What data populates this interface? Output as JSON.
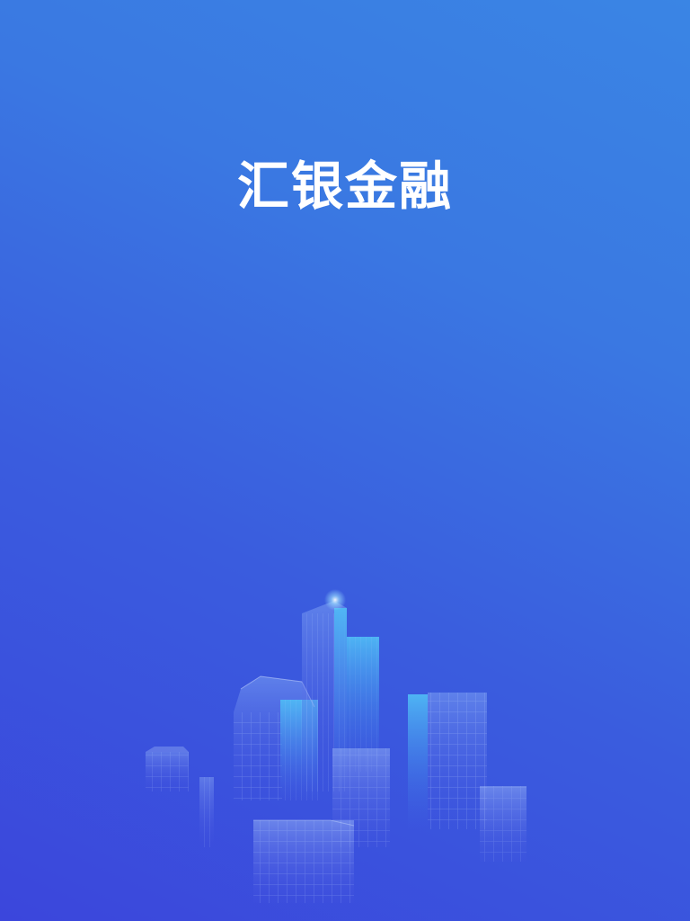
{
  "app": {
    "brand_name": "汇银金融"
  },
  "theme": {
    "bg_top": "#3A85E4",
    "bg_bottom": "#3B46DC",
    "text": "#FFFFFF"
  },
  "illustration": {
    "subject": "city-skyline"
  }
}
